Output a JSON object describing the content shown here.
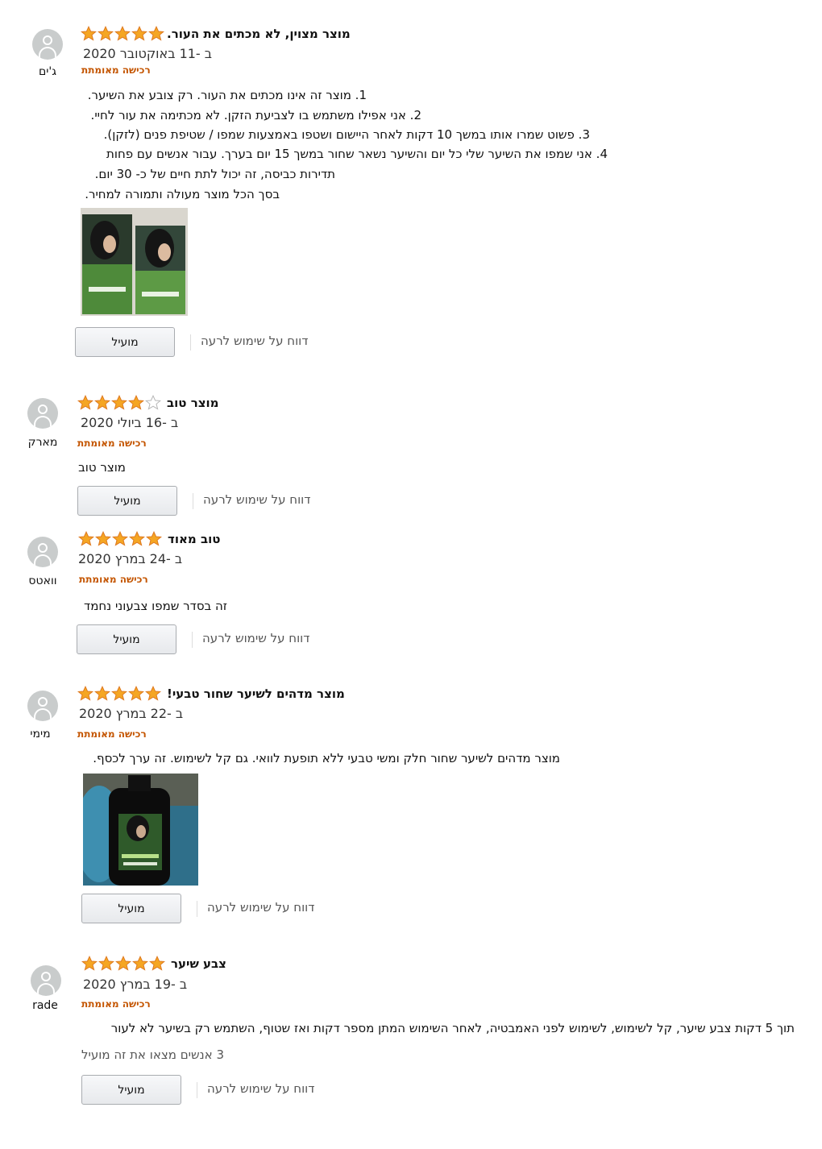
{
  "common": {
    "verified": "רכישה מאומתת",
    "helpful_btn": "מועיל",
    "report_link": "דווח על שימוש לרעה",
    "star_color": "#f5a623"
  },
  "reviews": [
    {
      "user": "ג'ים",
      "rating": 5,
      "title": "מוצר מצוין, לא מכתים את העור.",
      "date": "ב -11 באוקטובר 2020",
      "lines": [
        "1. מוצר זה אינו מכתים את העור. רק צובע את השיער.",
        "2. אני אפילו משתמש בו לצביעת הזקן. לא מכתימה את עור לחיי.",
        "3. פשוט שמרו אותו במשך 10 דקות לאחר היישום ושטפו באמצעות שמפו / שטיפת פנים (לזקן).",
        "4. אני שמפו את השיער שלי כל יום והשיער נשאר שחור במשך 15 יום בערך. עבור אנשים עם פחות",
        "תדירות כביסה, זה יכול לתת חיים של כ- 30 יום.",
        "בסך הכל מוצר מעולה ותמורה למחיר."
      ]
    },
    {
      "user": "מארק",
      "rating": 4,
      "title": "מוצר טוב",
      "date": "ב -16 ביולי 2020",
      "lines": [
        "מוצר טוב"
      ]
    },
    {
      "user": "וואטס",
      "rating": 5,
      "title": "טוב מאוד",
      "date": "ב -24 במרץ 2020",
      "lines": [
        "זה בסדר שמפו צבעוני נחמד"
      ]
    },
    {
      "user": "מימי",
      "rating": 5,
      "title": "מוצר מדהים לשיער שחור טבעי!",
      "date": "ב -22 במרץ 2020",
      "lines": [
        "מוצר מדהים לשיער שחור חלק ומשי טבעי ללא תופעת לוואי. גם קל לשימוש. זה ערך לכסף."
      ]
    },
    {
      "user": "rade",
      "rating": 5,
      "title": "צבע שיער",
      "date": "ב -19 במרץ 2020",
      "lines": [
        "תוך 5 דקות צבע שיער, קל לשימוש, לשימוש לפני האמבטיה, לאחר השימוש המתן מספר דקות ואז שטוף, השתמש רק בשיער לא לעור"
      ],
      "helpful_count": "3 אנשים מצאו את זה מועיל"
    }
  ]
}
